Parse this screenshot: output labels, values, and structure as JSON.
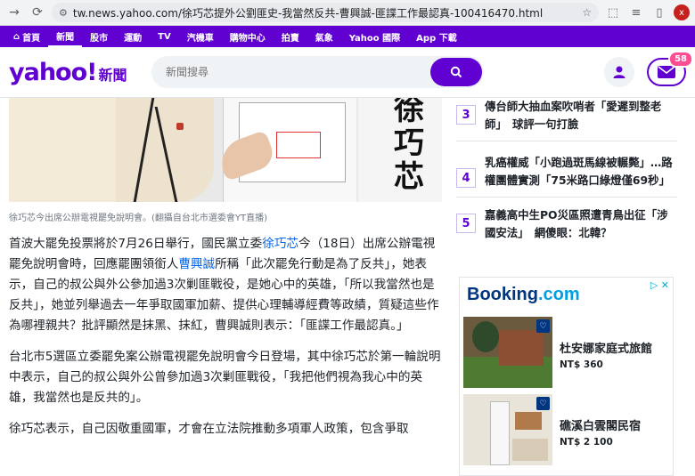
{
  "browser": {
    "url": "tw.news.yahoo.com/徐巧芯提外公劉匪史-我當然反共-曹興誠-匪諜工作最認真-100416470.html",
    "profile_initial": "x"
  },
  "topnav": {
    "items": [
      "首頁",
      "新聞",
      "股市",
      "運動",
      "TV",
      "汽機車",
      "購物中心",
      "拍賣",
      "氣象",
      "Yahoo 國際",
      "App 下載"
    ]
  },
  "header": {
    "logo_text": "yahoo!",
    "logo_suffix": "新聞",
    "search_placeholder": "新聞搜尋",
    "mail_badge": "58"
  },
  "photo": {
    "overlay_chars": [
      "徐",
      "巧",
      "芯"
    ],
    "caption": "徐巧芯今出席公辦電視罷免說明會。(翻攝自台北市選委會YT直播)"
  },
  "article": {
    "p1_a": "首波大罷免投票將於7月26日舉行，國民黨立委",
    "p1_link1": "徐巧芯",
    "p1_b": "今（18日）出席公辦電視罷免說明會時，回應罷團領銜人",
    "p1_link2": "曹興誠",
    "p1_c": "所稱「此次罷免行動是為了反共」，她表示，自己的叔公與外公參加過3次剿匪戰役，是她心中的英雄，「所以我當然也是反共」，她並列舉過去一年爭取國軍加薪、提供心理輔導經費等政績，質疑這些作為哪裡親共？批評顯然是抹黑、抹紅，曹興誠則表示：「匪諜工作最認真。」",
    "p2": "台北市5選區立委罷免案公辦電視罷免說明會今日登場，其中徐巧芯於第一輪說明中表示，自己的叔公與外公曾參加過3次剿匪戰役，「我把他們視為我心中的英雄，我當然也是反共的」。",
    "p3": "徐巧芯表示，自己因敬重國軍，才會在立法院推動多項軍人政策，包含爭取"
  },
  "trending": [
    {
      "num": "3",
      "text": "傳台師大抽血案吹哨者「愛遲到整老師」　球評一句打臉"
    },
    {
      "num": "4",
      "text": "乳癌權威「小跑過斑馬線被輾斃」…路權團體實測「75米路口綠燈僅69秒」"
    },
    {
      "num": "5",
      "text": "嘉義高中生PO災區照遭青鳥出征「涉國安法」　網傻眼：北韓？"
    }
  ],
  "ad": {
    "brand_main": "Booking",
    "brand_dot": ".com",
    "adchoice": "▷ ✕",
    "hotels": [
      {
        "name": "杜安娜家庭式旅館",
        "price": "NT$ 360"
      },
      {
        "name": "礁溪白雲閣民宿",
        "price": "NT$ 2 100"
      }
    ]
  },
  "colors": {
    "brand_purple": "#6001d2",
    "link_blue": "#0063eb",
    "booking_blue": "#003580",
    "badge_pink": "#ff4d94"
  }
}
